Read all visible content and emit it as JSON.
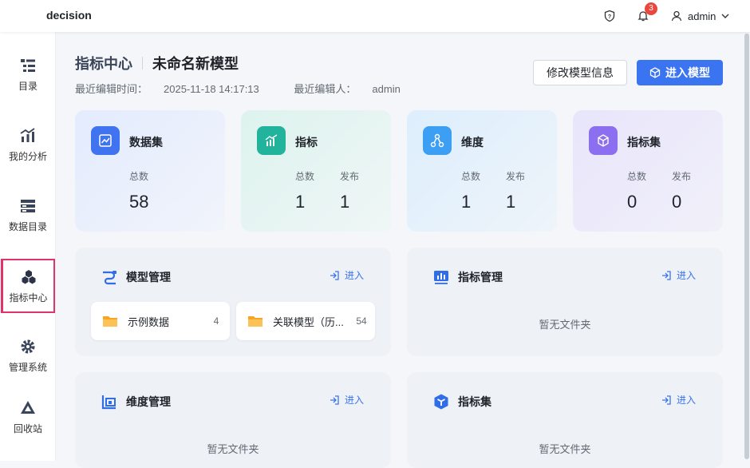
{
  "app": {
    "title": "decision"
  },
  "topbar": {
    "notification_count": "3",
    "user_name": "admin"
  },
  "sidebar": {
    "items": [
      {
        "label": "目录"
      },
      {
        "label": "我的分析"
      },
      {
        "label": "数据目录"
      },
      {
        "label": "指标中心"
      },
      {
        "label": "管理系统"
      },
      {
        "label": "回收站"
      }
    ]
  },
  "header": {
    "breadcrumb": "指标中心",
    "title": "未命名新模型",
    "edit_time_label": "最近编辑时间：",
    "edit_time": "2025-11-18 14:17:13",
    "editor_label": "最近编辑人：",
    "editor": "admin",
    "edit_button": "修改模型信息",
    "enter_button": "进入模型"
  },
  "stats": [
    {
      "title": "数据集",
      "labels": [
        "总数"
      ],
      "values": [
        "58"
      ]
    },
    {
      "title": "指标",
      "labels": [
        "总数",
        "发布"
      ],
      "values": [
        "1",
        "1"
      ]
    },
    {
      "title": "维度",
      "labels": [
        "总数",
        "发布"
      ],
      "values": [
        "1",
        "1"
      ]
    },
    {
      "title": "指标集",
      "labels": [
        "总数",
        "发布"
      ],
      "values": [
        "0",
        "0"
      ]
    }
  ],
  "panels": {
    "enter_label": "进入",
    "empty_text": "暂无文件夹",
    "model": {
      "title": "模型管理",
      "folders": [
        {
          "name": "示例数据",
          "count": "4"
        },
        {
          "name": "关联模型（历...",
          "count": "54"
        }
      ]
    },
    "metric": {
      "title": "指标管理"
    },
    "dimension": {
      "title": "维度管理"
    },
    "metric_set": {
      "title": "指标集"
    }
  },
  "colors": {
    "accent": "#3a74f1",
    "active_nav_border": "#e0336a",
    "badge": "#e9483f"
  }
}
